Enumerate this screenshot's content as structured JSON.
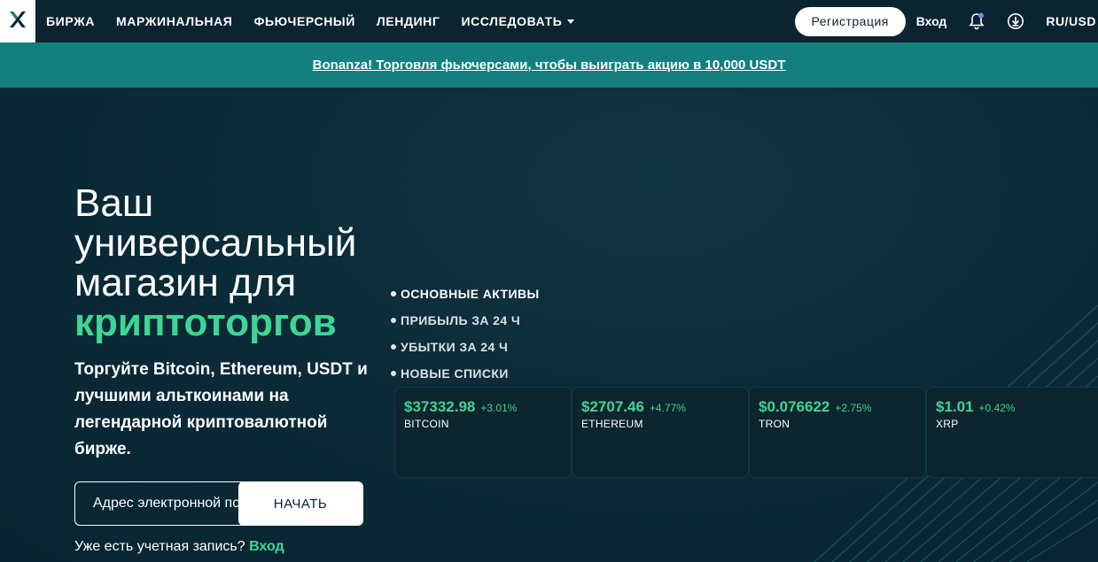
{
  "nav": {
    "links": [
      {
        "label": "БИРЖА"
      },
      {
        "label": "МАРЖИНАЛЬНАЯ"
      },
      {
        "label": "ФЬЮЧЕРСНЫЙ"
      },
      {
        "label": "ЛЕНДИНГ"
      },
      {
        "label": "ИССЛЕДОВАТЬ"
      }
    ],
    "register_label": "Регистрация",
    "login_label": "Вход",
    "currency_label": "RU/USD"
  },
  "banner": {
    "text": "Bonanza! Торговля фьючерсами, чтобы выиграть акцию в 10,000 USDT"
  },
  "hero": {
    "headline_line1": "Ваш",
    "headline_line2": "универсальный",
    "headline_line3": "магазин для",
    "headline_accent": "криптоторгов",
    "subtext": "Торгуйте Bitcoin, Ethereum, USDT и лучшими альткоинами на легендарной криптовалютной бирже.",
    "email_placeholder": "Адрес электронной почты",
    "start_label": "НАЧАТЬ",
    "have_account_text": "Уже есть учетная запись?",
    "have_account_link": "Вход"
  },
  "market": {
    "tabs": [
      {
        "label": "ОСНОВНЫЕ АКТИВЫ"
      },
      {
        "label": "ПРИБЫЛЬ ЗА 24 Ч"
      },
      {
        "label": "УБЫТКИ ЗА 24 Ч"
      },
      {
        "label": "НОВЫЕ СПИСКИ"
      }
    ],
    "cards": [
      {
        "price": "$37332.98",
        "change": "+3.01%",
        "name": "BITCOIN"
      },
      {
        "price": "$2707.46",
        "change": "+4.77%",
        "name": "ETHEREUM"
      },
      {
        "price": "$0.076622",
        "change": "+2.75%",
        "name": "TRON"
      },
      {
        "price": "$1.01",
        "change": "+0.42%",
        "name": "XRP"
      }
    ]
  },
  "colors": {
    "nav_bg": "#0a2430",
    "banner_bg": "#13807f",
    "accent_green": "#3ed694",
    "hero_bg": "#0b2a37"
  },
  "icons": {
    "logo": "x-logo-icon",
    "notifications": "bell-icon",
    "download": "download-icon",
    "caret": "caret-down-icon"
  }
}
